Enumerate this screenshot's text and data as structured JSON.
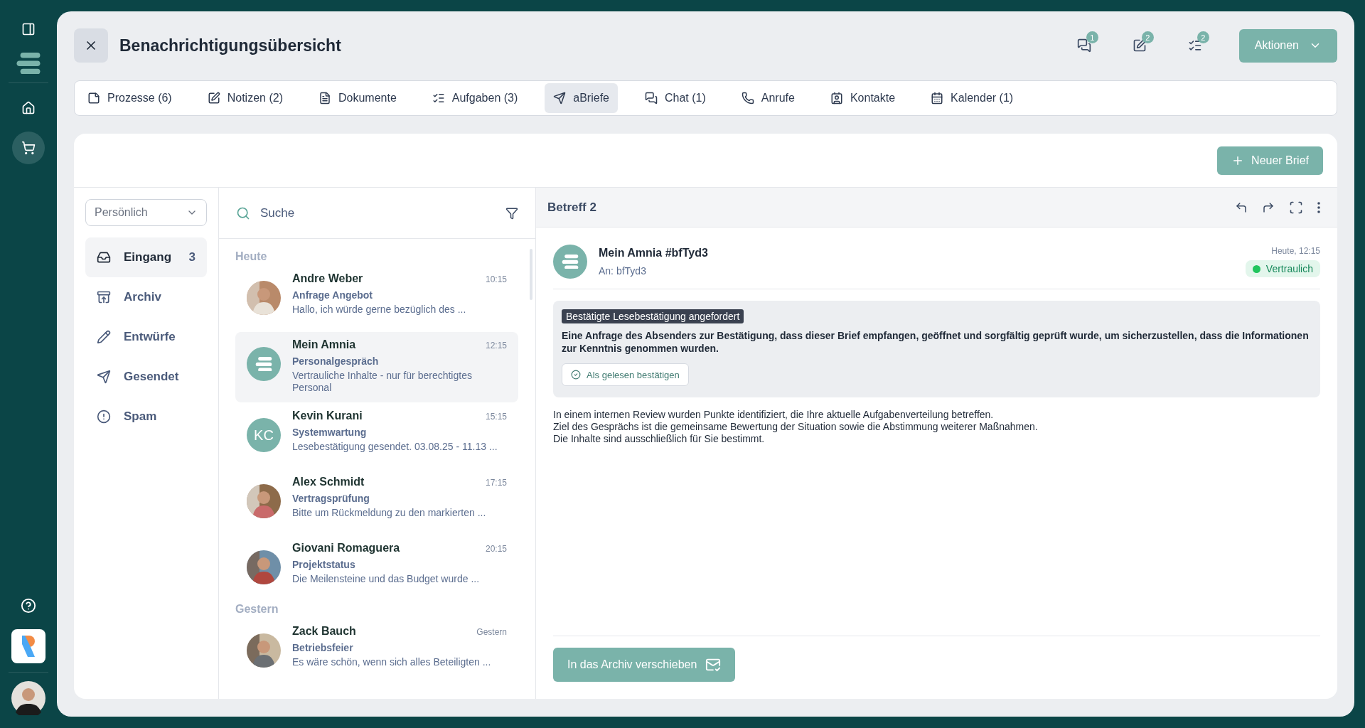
{
  "rail": {
    "items": [
      {
        "kind": "home",
        "selected": false
      },
      {
        "kind": "cart",
        "selected": true
      }
    ]
  },
  "header": {
    "title": "Benachrichtigungsübersicht",
    "indicators": [
      {
        "kind": "chat",
        "count": "1"
      },
      {
        "kind": "notes",
        "count": "2"
      },
      {
        "kind": "tasks",
        "count": "2"
      }
    ],
    "actions_button": "Aktionen"
  },
  "tabs": [
    {
      "kind": "processes",
      "label": "Prozesse (6)",
      "selected": false
    },
    {
      "kind": "notes",
      "label": "Notizen (2)",
      "selected": false
    },
    {
      "kind": "documents",
      "label": "Dokumente",
      "selected": false
    },
    {
      "kind": "tasks",
      "label": "Aufgaben (3)",
      "selected": false
    },
    {
      "kind": "letters",
      "label": "aBriefe",
      "selected": true
    },
    {
      "kind": "chat",
      "label": "Chat (1)",
      "selected": false
    },
    {
      "kind": "calls",
      "label": "Anrufe",
      "selected": false
    },
    {
      "kind": "contacts",
      "label": "Kontakte",
      "selected": false
    },
    {
      "kind": "calendar",
      "label": "Kalender (1)",
      "selected": false
    }
  ],
  "new_letter_button": "Neuer Brief",
  "folders": {
    "dropdown": "Persönlich",
    "items": [
      {
        "kind": "inbox",
        "label": "Eingang",
        "count": "3",
        "selected": true
      },
      {
        "kind": "archive",
        "label": "Archiv",
        "selected": false
      },
      {
        "kind": "drafts",
        "label": "Entwürfe",
        "selected": false
      },
      {
        "kind": "sent",
        "label": "Gesendet",
        "selected": false
      },
      {
        "kind": "spam",
        "label": "Spam",
        "selected": false
      }
    ]
  },
  "search": {
    "placeholder": "Suche"
  },
  "message_groups": [
    {
      "label": "Heute",
      "items": [
        {
          "sender": "Andre Weber",
          "time": "10:15",
          "subject": "Anfrage Angebot",
          "preview": "Hallo, ich würde gerne bezüglich des ...",
          "selected": false
        },
        {
          "kind": "logo",
          "sender": "Mein Amnia",
          "time": "12:15",
          "subject": "Personalgespräch",
          "preview": "Vertrauliche Inhalte - nur für berechtigtes Personal",
          "selected": true
        },
        {
          "kind": "initials",
          "initials": "KC",
          "sender": "Kevin Kurani",
          "time": "15:15",
          "subject": "Systemwartung",
          "preview": "Lesebestätigung gesendet. 03.08.25 - 11.13 ...",
          "selected": false
        },
        {
          "sender": "Alex Schmidt",
          "time": "17:15",
          "subject": "Vertragsprüfung",
          "preview": "Bitte um Rückmeldung zu den markierten ...",
          "selected": false
        },
        {
          "sender": "Giovani Romaguera",
          "time": "20:15",
          "subject": "Projektstatus",
          "preview": "Die Meilensteine und das Budget wurde ...",
          "selected": false
        }
      ]
    },
    {
      "label": "Gestern",
      "items": [
        {
          "sender": "Zack Bauch",
          "time": "Gestern",
          "subject": "Betriebsfeier",
          "preview": "Es wäre schön, wenn sich alles Beteiligten ...",
          "selected": false
        }
      ]
    }
  ],
  "detail": {
    "subject": "Betreff 2",
    "sender": "Mein Amnia #bfTyd3",
    "recipient": "An: bfTyd3",
    "date": "Heute, 12:15",
    "tag": {
      "label": "Vertraulich",
      "color": "#22c55e"
    },
    "notice": {
      "title": "Bestätigte Lesebestätigung angefordert",
      "text": "Eine Anfrage des Absenders zur Bestätigung, dass dieser Brief empfangen, geöffnet und sorgfältig geprüft wurde, um sicherzustellen, dass die Informationen zur Kenntnis genommen wurden.",
      "button": "Als gelesen bestätigen"
    },
    "body": [
      "In einem internen Review wurden Punkte identifiziert, die Ihre aktuelle Aufgabenverteilung betreffen.",
      "Ziel des Gesprächs ist die gemeinsame Bewertung der Situation sowie die Abstimmung weiterer Maßnahmen.",
      "Die Inhalte sind ausschließlich für Sie bestimmt."
    ],
    "archive_button": "In das Archiv verschieben"
  }
}
